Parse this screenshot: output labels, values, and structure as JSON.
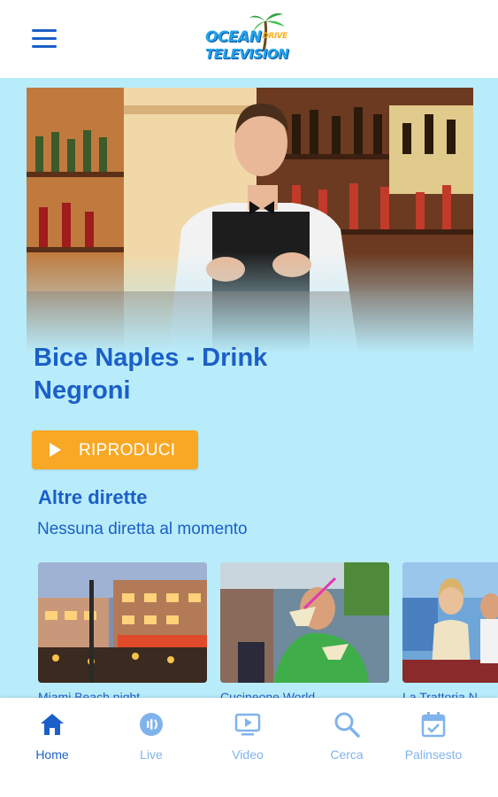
{
  "header": {
    "logo": {
      "line1": "OCEAN",
      "line1_small": "DRIVE",
      "line2": "TELEVISION"
    }
  },
  "featured": {
    "title": "Bice Naples - Drink Negroni",
    "play_label": "RIPRODUCI"
  },
  "live_section": {
    "title": "Altre dirette",
    "empty_message": "Nessuna diretta al momento"
  },
  "thumbnails": [
    {
      "label": "Miami Beach night"
    },
    {
      "label": "Cucineone World"
    },
    {
      "label": "La Trattoria N"
    }
  ],
  "bottom_nav": {
    "items": [
      {
        "label": "Home",
        "icon": "home-icon",
        "active": true
      },
      {
        "label": "Live",
        "icon": "live-icon",
        "active": false
      },
      {
        "label": "Video",
        "icon": "video-icon",
        "active": false
      },
      {
        "label": "Cerca",
        "icon": "search-icon",
        "active": false
      },
      {
        "label": "Palinsesto",
        "icon": "calendar-icon",
        "active": false
      }
    ]
  },
  "colors": {
    "background": "#b9ecfb",
    "primary": "#1b5fc8",
    "accent": "#f9a825",
    "inactive_nav": "#7fb3ec"
  }
}
